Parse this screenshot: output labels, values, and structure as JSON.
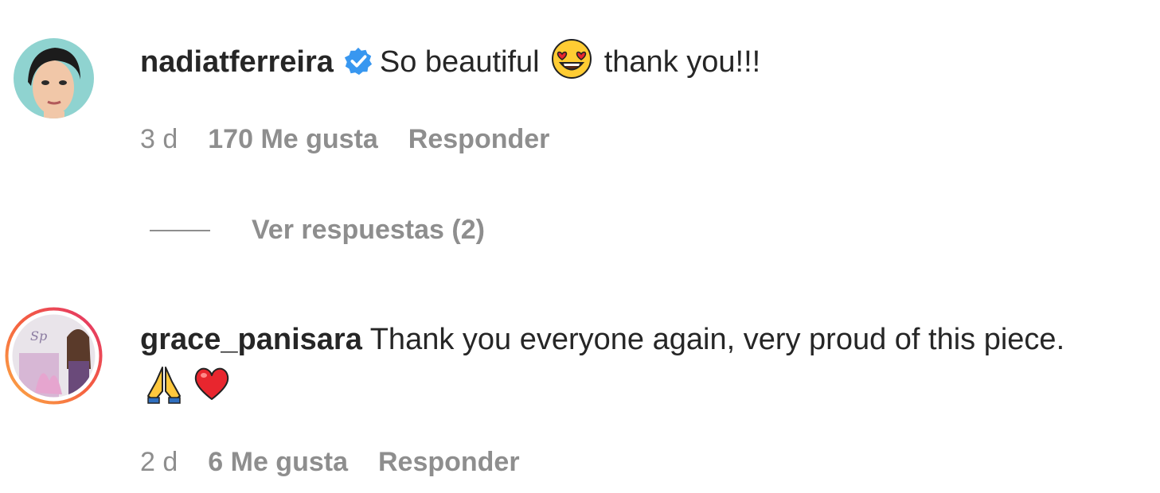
{
  "comments": [
    {
      "username": "nadiatferreira",
      "verified": true,
      "text_before_emoji": "So beautiful",
      "emoji_1": "heart-eyes-emoji",
      "text_after_emoji": "thank you!!!",
      "time": "3 d",
      "likes": "170 Me gusta",
      "reply_label": "Responder",
      "view_replies": "Ver respuestas (2)"
    },
    {
      "username": "grace_panisara",
      "text": "Thank you everyone again, very proud of this piece.",
      "emoji_1": "folded-hands-emoji",
      "emoji_2": "red-heart-emoji",
      "time": "2 d",
      "likes": "6 Me gusta",
      "reply_label": "Responder",
      "story_ring": true
    }
  ],
  "colors": {
    "primary_text": "#262626",
    "secondary_text": "#8e8e8e",
    "verified_blue": "#3897f0",
    "story_ring_start": "#fcaf45",
    "story_ring_end": "#e1306c"
  }
}
